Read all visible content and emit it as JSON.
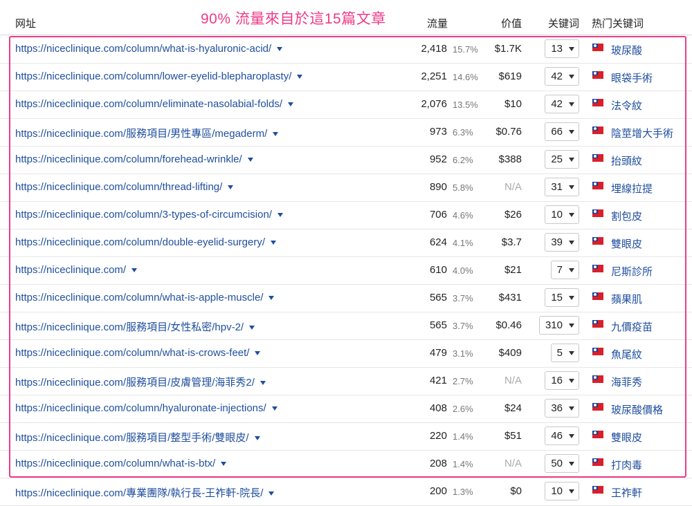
{
  "header": {
    "url": "网址",
    "traffic": "流量",
    "value": "价值",
    "keywords": "关键词",
    "top_keyword": "热门关键词"
  },
  "annotation": "90% 流量來自於這15篇文章",
  "rows": [
    {
      "url": "https://niceclinique.com/column/what-is-hyaluronic-acid/",
      "traffic": "2,418",
      "pct": "15.7%",
      "value": "$1.7K",
      "kw": "13",
      "top": "玻尿酸"
    },
    {
      "url": "https://niceclinique.com/column/lower-eyelid-blepharoplasty/",
      "traffic": "2,251",
      "pct": "14.6%",
      "value": "$619",
      "kw": "42",
      "top": "眼袋手術"
    },
    {
      "url": "https://niceclinique.com/column/eliminate-nasolabial-folds/",
      "traffic": "2,076",
      "pct": "13.5%",
      "value": "$10",
      "kw": "42",
      "top": "法令紋"
    },
    {
      "url": "https://niceclinique.com/服務項目/男性專區/megaderm/",
      "traffic": "973",
      "pct": "6.3%",
      "value": "$0.76",
      "kw": "66",
      "top": "陰莖增大手術"
    },
    {
      "url": "https://niceclinique.com/column/forehead-wrinkle/",
      "traffic": "952",
      "pct": "6.2%",
      "value": "$388",
      "kw": "25",
      "top": "抬頭紋"
    },
    {
      "url": "https://niceclinique.com/column/thread-lifting/",
      "traffic": "890",
      "pct": "5.8%",
      "value": "N/A",
      "kw": "31",
      "top": "埋線拉提"
    },
    {
      "url": "https://niceclinique.com/column/3-types-of-circumcision/",
      "traffic": "706",
      "pct": "4.6%",
      "value": "$26",
      "kw": "10",
      "top": "割包皮"
    },
    {
      "url": "https://niceclinique.com/column/double-eyelid-surgery/",
      "traffic": "624",
      "pct": "4.1%",
      "value": "$3.7",
      "kw": "39",
      "top": "雙眼皮"
    },
    {
      "url": "https://niceclinique.com/",
      "traffic": "610",
      "pct": "4.0%",
      "value": "$21",
      "kw": "7",
      "top": "尼斯診所"
    },
    {
      "url": "https://niceclinique.com/column/what-is-apple-muscle/",
      "traffic": "565",
      "pct": "3.7%",
      "value": "$431",
      "kw": "15",
      "top": "蘋果肌"
    },
    {
      "url": "https://niceclinique.com/服務項目/女性私密/hpv-2/",
      "traffic": "565",
      "pct": "3.7%",
      "value": "$0.46",
      "kw": "310",
      "top": "九價疫苗"
    },
    {
      "url": "https://niceclinique.com/column/what-is-crows-feet/",
      "traffic": "479",
      "pct": "3.1%",
      "value": "$409",
      "kw": "5",
      "top": "魚尾紋"
    },
    {
      "url": "https://niceclinique.com/服務項目/皮膚管理/海菲秀2/",
      "traffic": "421",
      "pct": "2.7%",
      "value": "N/A",
      "kw": "16",
      "top": "海菲秀"
    },
    {
      "url": "https://niceclinique.com/column/hyaluronate-injections/",
      "traffic": "408",
      "pct": "2.6%",
      "value": "$24",
      "kw": "36",
      "top": "玻尿酸價格"
    },
    {
      "url": "https://niceclinique.com/服務項目/整型手術/雙眼皮/",
      "traffic": "220",
      "pct": "1.4%",
      "value": "$51",
      "kw": "46",
      "top": "雙眼皮"
    },
    {
      "url": "https://niceclinique.com/column/what-is-btx/",
      "traffic": "208",
      "pct": "1.4%",
      "value": "N/A",
      "kw": "50",
      "top": "打肉毒"
    },
    {
      "url": "https://niceclinique.com/專業團隊/執行長-王祚軒-院長/",
      "traffic": "200",
      "pct": "1.3%",
      "value": "$0",
      "kw": "10",
      "top": "王祚軒"
    }
  ],
  "colors": {
    "link": "#1f4e9e",
    "highlight": "#ee3a87",
    "muted": "#777777",
    "na": "#aaaaaa"
  },
  "icons": {
    "caret": "caret-down-icon",
    "flag": "taiwan-flag-icon"
  }
}
